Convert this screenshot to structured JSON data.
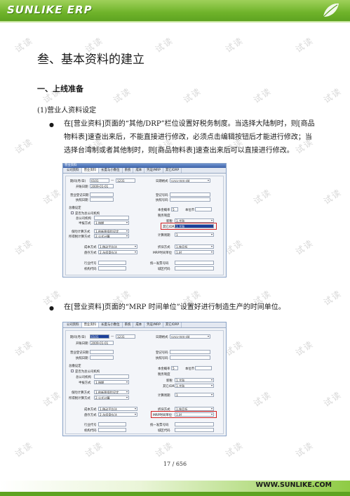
{
  "header": {
    "logo": "SUNLIKE ERP"
  },
  "watermark": "试读",
  "title": "叁、基本资料的建立",
  "section": "一、上线准备",
  "subsection": "(1)营业人资料设定",
  "bullets": [
    "在[营业资料]页面的“其他/DRP”栏位设置好税务制度。当选择大陆制时，则[商品物料表]速查出来后，不能直接进行修改，必须点击编辑按钮后才能进行修改；当选择台湾制或者其他制时，则[商品物料表]速查出来后可以直接进行修改。",
    "在[营业资料]页面的“MRP 时间单位”设置好进行制造生产的时间单位。"
  ],
  "window1": {
    "title": "营业资料",
    "tabs": [
      "公司资料",
      "营业资料",
      "长度与小数位",
      "系统",
      "成本",
      "凭证/MRP",
      "其它/DRP"
    ],
    "active_tab": 1,
    "period_label": "期间(月/日)",
    "period_from": "0101",
    "period_to": "1231",
    "start_label": "开账日期",
    "start_value": "2009-01-01",
    "date_fmt_label": "日期格式",
    "date_fmt_value": "yyyy-mm-dd",
    "reg_date_label": "营业登记日期",
    "exec_date_label": "执照日期",
    "reg_no_label": "登记号码",
    "exec_no_label": "执照号码",
    "branch_group": "总缴设定",
    "branch_chk": "是否为总公司机构",
    "hq_code_label": "总公司机构",
    "halfyear_label": "半报方式",
    "halfyear_value": "1.按期",
    "currency_label": "本金概率",
    "currency_value": "5",
    "unit_label": "本位币",
    "tax_group": "税务制度",
    "tax_sys_label": "新税",
    "tax_sys_value": "1.大陆",
    "other_drp_label": "其它/DRP",
    "other_drp_value": "1.大陆",
    "insure_label": "保险计算方式",
    "insure_value": "1.依新税保险设定",
    "wage_label": "所得税计算方式",
    "wage_value": "2.公式计算",
    "calc_label": "计算周期",
    "calc_value": "1",
    "cost_label": "成本方式",
    "cost_value": "1.移动平均法",
    "inv_label": "盘存方式",
    "inv_value": "2.永续盘存法",
    "disc_label": "折旧方式",
    "disc_value": "1.按月折",
    "mrp_label": "MRP时间单位",
    "mrp_value": "1.时",
    "industry_label": "行业代号",
    "org_label": "机构代码",
    "invoice_label": "统一发票号码",
    "area_label": "城区代码"
  },
  "footer": {
    "page": "17 / 656",
    "url": "WWW.SUNLIKE.COM"
  }
}
